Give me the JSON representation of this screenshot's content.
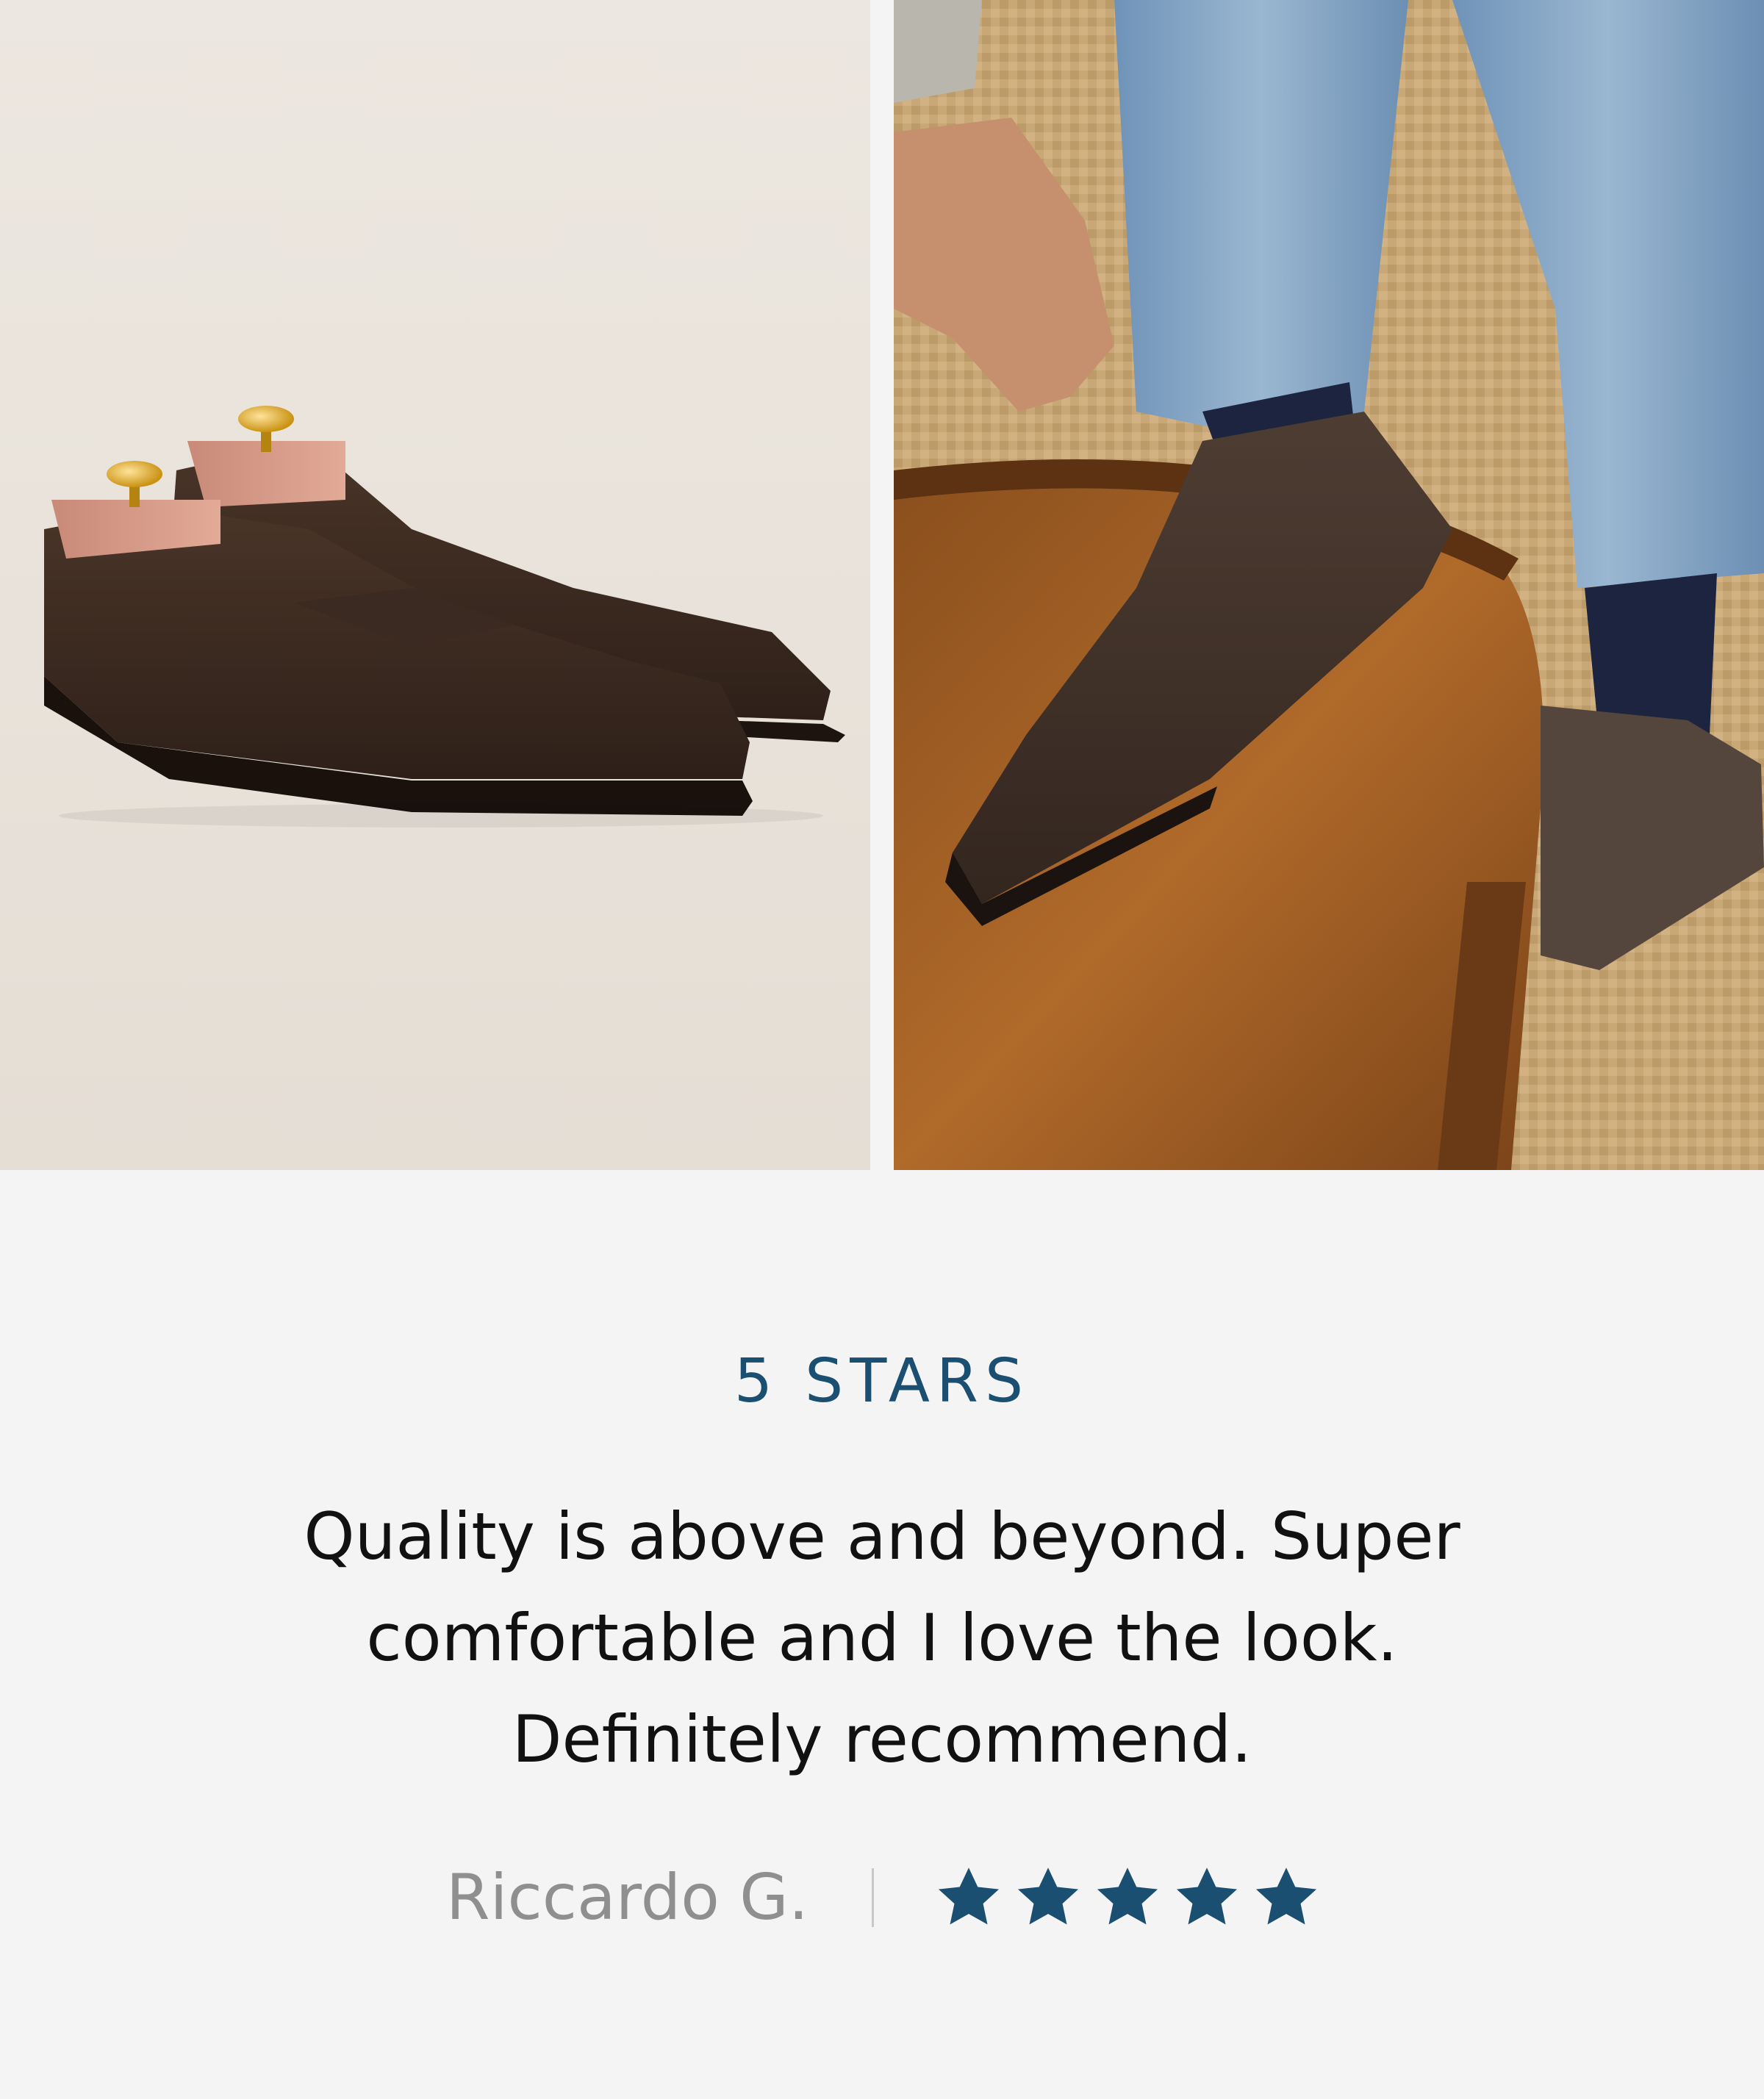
{
  "images": {
    "left": {
      "alt": ""
    },
    "right": {
      "alt": ""
    }
  },
  "review": {
    "heading": "5 STARS",
    "quote_lines": [
      "Quality is above and beyond. Super",
      "comfortable and I love the look.",
      "Definitely recommend."
    ],
    "author": "Riccardo G.",
    "rating": 5,
    "rating_max": 5
  },
  "colors": {
    "accent": "#1b4f72",
    "background": "#f4f4f4",
    "quote_text": "#111111",
    "author_text": "#8f8f8f"
  },
  "icons": {
    "star": "star-icon"
  }
}
